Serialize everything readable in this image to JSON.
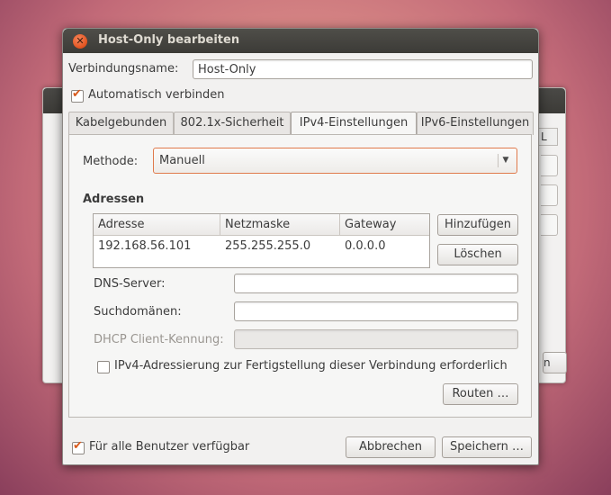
{
  "dialog": {
    "title": "Host-Only bearbeiten",
    "connection_name_label": "Verbindungsname:",
    "connection_name_value": "Host-Only",
    "auto_connect_label": "Automatisch verbinden",
    "auto_connect_checked": true,
    "available_all_users_label": "Für alle Benutzer verfügbar",
    "available_all_users_checked": true,
    "cancel_label": "Abbrechen",
    "save_label": "Speichern …"
  },
  "tabs": [
    {
      "label": "Kabelgebunden",
      "active": false
    },
    {
      "label": "802.1x-Sicherheit",
      "active": false
    },
    {
      "label": "IPv4-Einstellungen",
      "active": true
    },
    {
      "label": "IPv6-Einstellungen",
      "active": false
    }
  ],
  "ipv4": {
    "method_label": "Methode:",
    "method_value": "Manuell",
    "addresses_heading": "Adressen",
    "columns": [
      "Adresse",
      "Netzmaske",
      "Gateway"
    ],
    "rows": [
      {
        "address": "192.168.56.101",
        "netmask": "255.255.255.0",
        "gateway": "0.0.0.0"
      }
    ],
    "add_label": "Hinzufügen",
    "delete_label": "Löschen",
    "dns_label": "DNS-Server:",
    "dns_value": "",
    "search_domains_label": "Suchdomänen:",
    "search_domains_value": "",
    "dhcp_client_id_label": "DHCP Client-Kennung:",
    "dhcp_client_id_value": "",
    "require_ipv4_label": "IPv4-Adressierung zur Fertigstellung dieser Verbindung erforderlich",
    "require_ipv4_checked": false,
    "routes_label": "Routen …"
  },
  "background_window": {
    "tab_fragment": "L",
    "button_fragment": "n"
  },
  "colors": {
    "titlebar": "#3c3b37",
    "close_button": "#e2521e",
    "checkbox_check": "#d85a1c",
    "focus_border": "#e07a4c"
  }
}
